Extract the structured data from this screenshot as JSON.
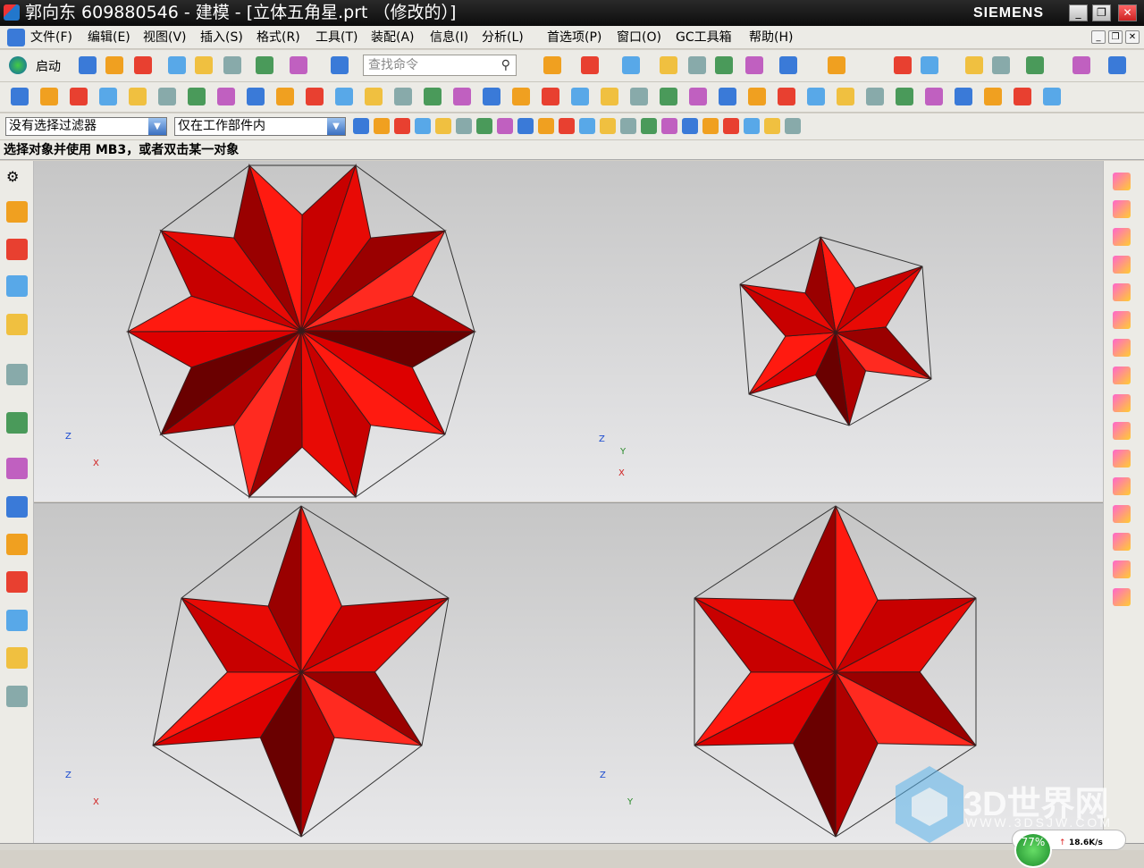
{
  "title": {
    "text": "郭向东 609880546 - 建模 - [立体五角星.prt （修改的）]",
    "brand": "SIEMENS",
    "minimize": "_",
    "restore": "❐",
    "close": "✕"
  },
  "menu": [
    "文件(F)",
    "编辑(E)",
    "视图(V)",
    "插入(S)",
    "格式(R)",
    "工具(T)",
    "装配(A)",
    "信息(I)",
    "分析(L)",
    "首选项(P)",
    "窗口(O)",
    "GC工具箱",
    "帮助(H)"
  ],
  "toolbar": {
    "start_label": "启动",
    "search_placeholder": "查找命令",
    "filter_value": "没有选择过滤器",
    "scope_value": "仅在工作部件内"
  },
  "cue_line": "选择对象并使用 MB3，或者双击某一对象",
  "colors": {
    "model_red": "#ff1a10",
    "dark_red": "#8a0000",
    "accent": "#2f6fd0"
  },
  "triad": {
    "x": "X",
    "y": "Y",
    "z": "Z"
  },
  "left_icons": [
    "gear-icon",
    "assembly-navigator-icon",
    "constraint-navigator-icon",
    "part-navigator-icon",
    "reuse-library-icon",
    "info-icon",
    "web-browser-icon",
    "history-icon",
    "color-palette-icon",
    "process-studio-icon",
    "roles-icon",
    "system-materials-icon",
    "drawing-icon",
    "template-icon"
  ],
  "right_icons": [
    "move-face-icon",
    "move-icon",
    "offset-icon",
    "replace-icon",
    "cylinder-icon",
    "copy-face-icon",
    "delete-face-icon",
    "remove-icon",
    "pattern-icon",
    "mirror-icon",
    "resize-icon",
    "face-icon",
    "label-icon",
    "draft-icon",
    "chamfer-icon",
    "blend-icon"
  ],
  "watermark": {
    "text": "3D世界网",
    "url": "WWW.3DSJW.COM"
  },
  "network": {
    "percent": "77%",
    "speed": "18.6K/s"
  }
}
